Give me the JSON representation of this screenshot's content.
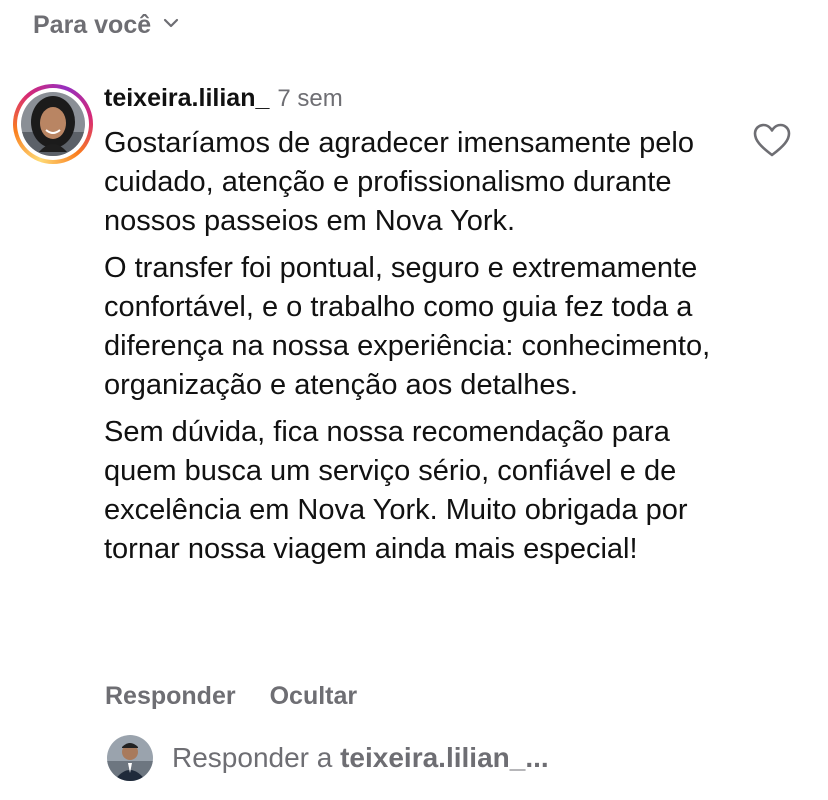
{
  "filter": {
    "label": "Para você",
    "icon": "chevron-down-icon"
  },
  "comment": {
    "username": "teixeira.lilian_",
    "time": "7 sem",
    "paragraphs": [
      "Gostaríamos de agradecer imensamente pelo cuidado, atenção e profissionalismo durante nossos passeios em Nova York.",
      "O transfer foi pontual, seguro e extremamente confortável, e o trabalho como guia fez toda a diferença na nossa experiência: conhecimento, organização e atenção aos detalhes.",
      "Sem dúvida, fica nossa recomendação para quem busca um serviço sério, confiável e de excelência em Nova York. Muito obrigada por tornar nossa viagem ainda mais especial!"
    ],
    "like_icon": "heart-icon",
    "actions": {
      "reply": "Responder",
      "hide": "Ocultar"
    }
  },
  "reply_bar": {
    "prefix": "Responder a ",
    "target": "teixeira.lilian_..."
  },
  "colors": {
    "text_primary": "#111111",
    "text_secondary": "#6e6e73",
    "background": "#ffffff"
  }
}
